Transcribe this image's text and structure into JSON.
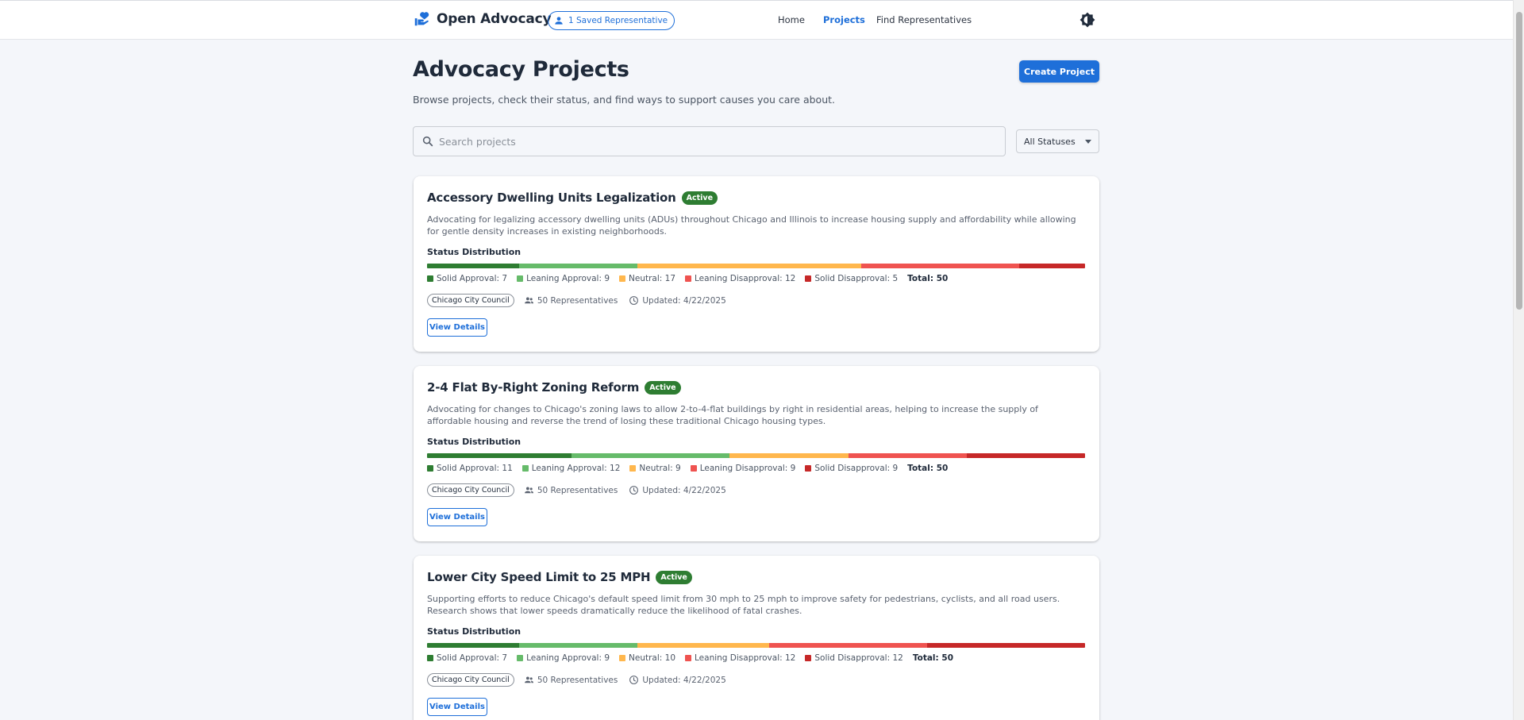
{
  "app": {
    "name": "Open Advocacy",
    "saved_reps_label": "1 Saved Representative"
  },
  "nav": {
    "home": "Home",
    "projects": "Projects",
    "find_reps": "Find Representatives"
  },
  "header": {
    "title": "Advocacy Projects",
    "subtitle": "Browse projects, check their status, and find ways to support causes you care about.",
    "create_label": "Create Project"
  },
  "search": {
    "placeholder": "Search projects",
    "value": ""
  },
  "filter": {
    "selected": "All Statuses"
  },
  "status_colors": {
    "solid_approval": "#2e7d32",
    "leaning_approval": "#66bb6a",
    "neutral": "#ffb74d",
    "leaning_disapproval": "#ef5350",
    "solid_disapproval": "#c62828"
  },
  "projects": [
    {
      "title": "Accessory Dwelling Units Legalization",
      "status": "Active",
      "description": "Advocating for legalizing accessory dwelling units (ADUs) throughout Chicago and Illinois to increase housing supply and affordability while allowing for gentle density increases in existing neighborhoods.",
      "dist_label": "Status Distribution",
      "legend": {
        "solid_approval": "Solid Approval: 7",
        "leaning_approval": "Leaning Approval: 9",
        "neutral": "Neutral: 17",
        "leaning_disapproval": "Leaning Disapproval: 12",
        "solid_disapproval": "Solid Disapproval: 5",
        "total": "Total: 50"
      },
      "counts": [
        7,
        9,
        17,
        12,
        5
      ],
      "jurisdiction": "Chicago City Council",
      "representatives": "50 Representatives",
      "updated": "Updated: 4/22/2025",
      "view_label": "View Details"
    },
    {
      "title": "2-4 Flat By-Right Zoning Reform",
      "status": "Active",
      "description": "Advocating for changes to Chicago's zoning laws to allow 2-to-4-flat buildings by right in residential areas, helping to increase the supply of affordable housing and reverse the trend of losing these traditional Chicago housing types.",
      "dist_label": "Status Distribution",
      "legend": {
        "solid_approval": "Solid Approval: 11",
        "leaning_approval": "Leaning Approval: 12",
        "neutral": "Neutral: 9",
        "leaning_disapproval": "Leaning Disapproval: 9",
        "solid_disapproval": "Solid Disapproval: 9",
        "total": "Total: 50"
      },
      "counts": [
        11,
        12,
        9,
        9,
        9
      ],
      "jurisdiction": "Chicago City Council",
      "representatives": "50 Representatives",
      "updated": "Updated: 4/22/2025",
      "view_label": "View Details"
    },
    {
      "title": "Lower City Speed Limit to 25 MPH",
      "status": "Active",
      "description": "Supporting efforts to reduce Chicago's default speed limit from 30 mph to 25 mph to improve safety for pedestrians, cyclists, and all road users. Research shows that lower speeds dramatically reduce the likelihood of fatal crashes.",
      "dist_label": "Status Distribution",
      "legend": {
        "solid_approval": "Solid Approval: 7",
        "leaning_approval": "Leaning Approval: 9",
        "neutral": "Neutral: 10",
        "leaning_disapproval": "Leaning Disapproval: 12",
        "solid_disapproval": "Solid Disapproval: 12",
        "total": "Total: 50"
      },
      "counts": [
        7,
        9,
        10,
        12,
        12
      ],
      "jurisdiction": "Chicago City Council",
      "representatives": "50 Representatives",
      "updated": "Updated: 4/22/2025",
      "view_label": "View Details"
    }
  ]
}
